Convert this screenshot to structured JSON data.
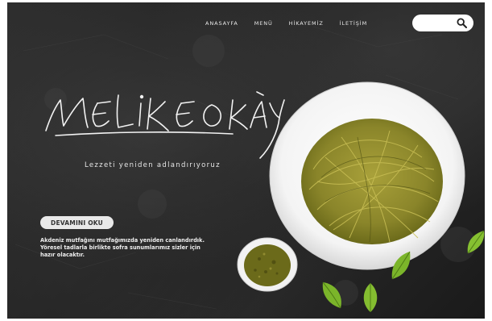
{
  "nav": {
    "items": [
      {
        "label": "ANASAYFA"
      },
      {
        "label": "MENÜ"
      },
      {
        "label": "HİKAYEMİZ"
      },
      {
        "label": "İLETİŞİM"
      }
    ]
  },
  "search": {
    "placeholder": ""
  },
  "brand": {
    "name": "MELİKE OKAY",
    "tagline": "Lezzeti yeniden adlandırıyoruz"
  },
  "hero": {
    "button_label": "DEVAMINI OKU",
    "description": "Akdeniz mutfağını mutfağımızda yeniden canlandırdık. Yöresel tadlarla birlikte sofra sunumlarımız sizler için hazır olacaktır."
  },
  "colors": {
    "background": "#232323",
    "text": "#f0f0f0",
    "button_bg": "#e9e9e9",
    "pesto": "#6b6a1a",
    "leaf": "#7bb52a"
  },
  "icons": [
    "search-icon",
    "basil-leaf-icon"
  ]
}
